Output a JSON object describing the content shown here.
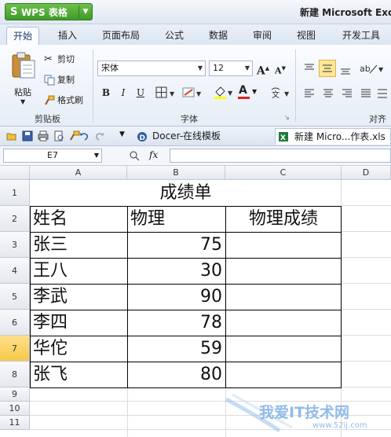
{
  "app": {
    "name": "WPS 表格",
    "logo_letter": "S",
    "window_title": "新建 Microsoft Exce"
  },
  "ribbon_tabs": [
    "开始",
    "插入",
    "页面布局",
    "公式",
    "数据",
    "审阅",
    "视图",
    "开发工具"
  ],
  "ribbon": {
    "paste_label": "粘贴",
    "cut_label": "剪切",
    "copy_label": "复制",
    "format_painter_label": "格式刷",
    "clipboard_group": "剪贴板",
    "font_name": "宋体",
    "font_size": "12",
    "bold": "B",
    "italic": "I",
    "underline": "U",
    "grow_font": "A",
    "shrink_font": "A",
    "font_color_glyph": "A",
    "font_group": "字体",
    "align_group": "对齐"
  },
  "doc_tabs": [
    {
      "label": "Docer-在线模板",
      "active": false
    },
    {
      "label": "新建 Micro...作表.xls",
      "active": true
    }
  ],
  "formula_bar": {
    "name_box": "E7",
    "fx": "fx",
    "content": ""
  },
  "columns": [
    "A",
    "B",
    "C",
    "D"
  ],
  "rows": [
    "1",
    "2",
    "3",
    "4",
    "5",
    "6",
    "7",
    "8",
    "9",
    "10",
    "11"
  ],
  "selected_row": "7",
  "sheet": {
    "title": "成绩单",
    "headers": [
      "姓名",
      "物理",
      "物理成绩"
    ],
    "records": [
      {
        "name": "张三",
        "physics": "75"
      },
      {
        "name": "王八",
        "physics": "30"
      },
      {
        "name": "李武",
        "physics": "90"
      },
      {
        "name": "李四",
        "physics": "78"
      },
      {
        "name": "华佗",
        "physics": "59"
      },
      {
        "name": "张飞",
        "physics": "80"
      }
    ]
  },
  "watermark": {
    "main": "我爱IT技术网",
    "url": "www.52ij.com"
  }
}
